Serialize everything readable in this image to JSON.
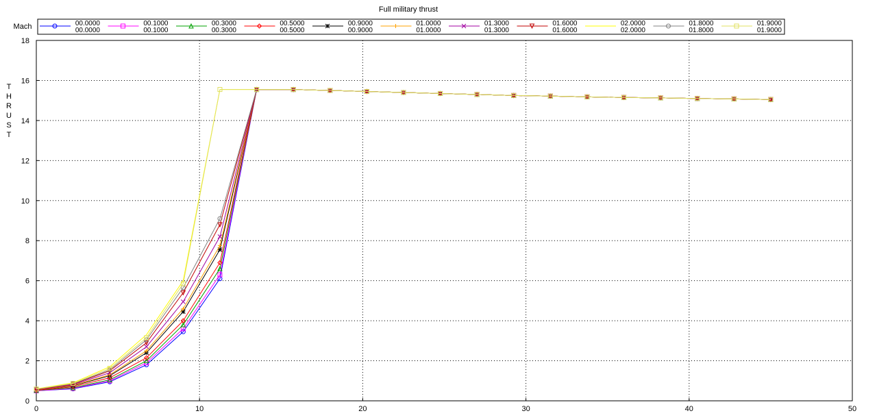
{
  "chart_data": {
    "type": "line",
    "title": "Full military thrust",
    "xlabel": "",
    "ylabel": "THRUST",
    "legend_title": "Mach",
    "legend_placement": "top",
    "xlim": [
      0,
      50
    ],
    "ylim": [
      0,
      18
    ],
    "xticks": [
      "0",
      "10",
      "20",
      "30",
      "40",
      "50"
    ],
    "yticks": [
      "0",
      "2",
      "4",
      "6",
      "8",
      "10",
      "12",
      "14",
      "16",
      "18"
    ],
    "grid": true,
    "x": [
      0,
      2.25,
      4.5,
      6.75,
      9.0,
      11.25,
      13.5,
      15.75,
      18.0,
      20.25,
      22.5,
      24.75,
      27.0,
      29.25,
      31.5,
      33.75,
      36.0,
      38.25,
      40.5,
      42.75,
      45.0
    ],
    "tail": [
      15.55,
      15.55,
      15.5,
      15.45,
      15.4,
      15.35,
      15.3,
      15.25,
      15.22,
      15.18,
      15.15,
      15.13,
      15.1,
      15.08,
      15.05
    ],
    "series": [
      {
        "name": "00.0000",
        "name2": "00.0000",
        "color": "#0000ff",
        "marker": "circle",
        "low": [
          0.5,
          0.6,
          0.95,
          1.8,
          3.45,
          6.1
        ]
      },
      {
        "name": "00.1000",
        "name2": "00.1000",
        "color": "#ff00ff",
        "marker": "square",
        "low": [
          0.5,
          0.62,
          1.0,
          1.9,
          3.6,
          6.3
        ]
      },
      {
        "name": "00.3000",
        "name2": "00.3000",
        "color": "#00a000",
        "marker": "triangle",
        "low": [
          0.52,
          0.65,
          1.05,
          2.0,
          3.8,
          6.6
        ]
      },
      {
        "name": "00.5000",
        "name2": "00.5000",
        "color": "#ff0000",
        "marker": "diamond",
        "low": [
          0.53,
          0.7,
          1.15,
          2.15,
          4.0,
          6.9
        ]
      },
      {
        "name": "00.9000",
        "name2": "00.9000",
        "color": "#000000",
        "marker": "star",
        "low": [
          0.55,
          0.75,
          1.25,
          2.4,
          4.45,
          7.55
        ]
      },
      {
        "name": "01.0000",
        "name2": "01.0000",
        "color": "#ffa000",
        "marker": "plus",
        "low": [
          0.55,
          0.77,
          1.3,
          2.5,
          4.6,
          7.75
        ]
      },
      {
        "name": "01.3000",
        "name2": "01.3000",
        "color": "#a000a0",
        "marker": "cross",
        "low": [
          0.56,
          0.8,
          1.4,
          2.7,
          4.95,
          8.2
        ]
      },
      {
        "name": "01.6000",
        "name2": "01.6000",
        "color": "#c00000",
        "marker": "invtri",
        "low": [
          0.57,
          0.83,
          1.5,
          2.9,
          5.4,
          8.8
        ]
      },
      {
        "name": "02.0000",
        "name2": "02.0000",
        "color": "#ffff00",
        "marker": "none",
        "low": [
          0.6,
          0.9,
          1.7,
          3.3,
          6.0,
          15.55
        ]
      },
      {
        "name": "01.8000",
        "name2": "01.8000",
        "color": "#808080",
        "marker": "circle",
        "low": [
          0.58,
          0.85,
          1.55,
          3.05,
          5.65,
          9.1
        ]
      },
      {
        "name": "01.9000",
        "name2": "01.9000",
        "color": "#e0e060",
        "marker": "square",
        "low": [
          0.59,
          0.87,
          1.62,
          3.15,
          5.85,
          15.55
        ]
      }
    ]
  }
}
